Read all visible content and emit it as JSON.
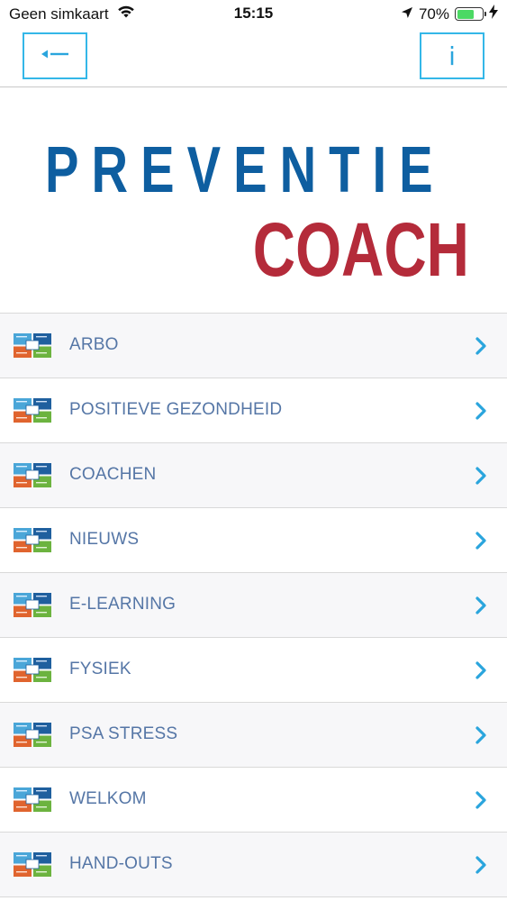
{
  "status_bar": {
    "carrier": "Geen simkaart",
    "time": "15:15",
    "battery_percent": "70%",
    "battery_level": 0.7,
    "battery_color": "#4cd964",
    "icons": [
      "wifi-icon",
      "location-arrow-icon",
      "battery-icon",
      "charging-bolt-icon"
    ]
  },
  "nav": {
    "back_icon": "back-arrow-icon",
    "info_label": "i",
    "accent_color": "#34b7e8"
  },
  "logo": {
    "line1": "PREVENTIE",
    "line2": "COACH",
    "line1_color": "#0e5ea0",
    "line2_color": "#b42b3a"
  },
  "menu": {
    "label_color": "#5576a6",
    "chevron_color": "#2aa5dd",
    "items": [
      {
        "label": "ARBO",
        "icon": "card-grid-icon"
      },
      {
        "label": "POSITIEVE GEZONDHEID",
        "icon": "card-grid-icon"
      },
      {
        "label": "COACHEN",
        "icon": "card-grid-icon"
      },
      {
        "label": "NIEUWS",
        "icon": "card-grid-icon"
      },
      {
        "label": "E-LEARNING",
        "icon": "card-grid-icon"
      },
      {
        "label": "FYSIEK",
        "icon": "card-grid-icon"
      },
      {
        "label": "PSA STRESS",
        "icon": "card-grid-icon"
      },
      {
        "label": "WELKOM",
        "icon": "card-grid-icon"
      },
      {
        "label": "HAND-OUTS",
        "icon": "card-grid-icon"
      }
    ]
  }
}
